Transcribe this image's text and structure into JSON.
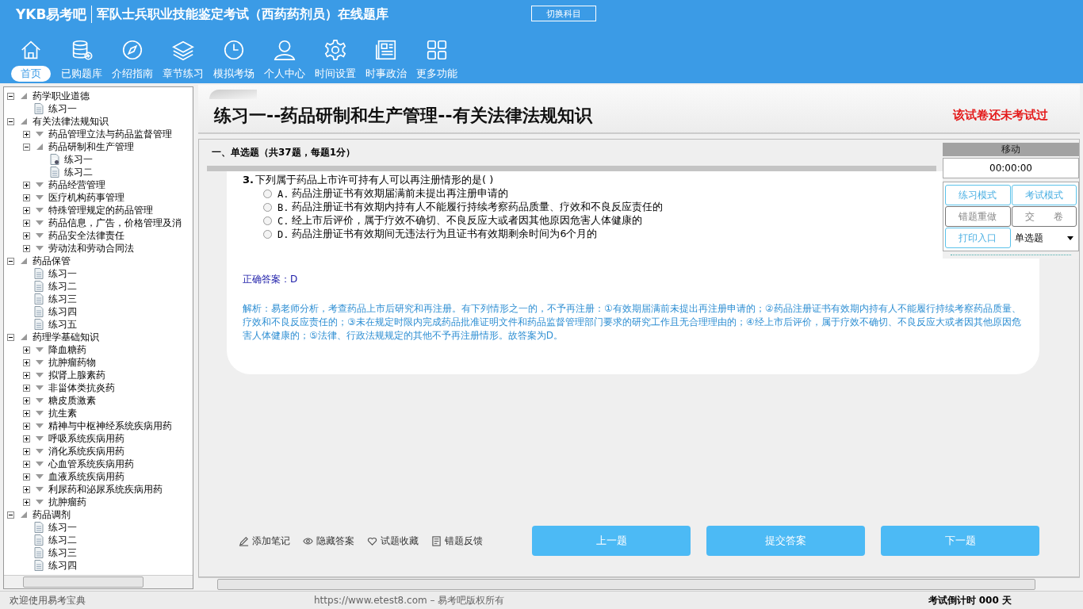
{
  "header": {
    "logo": "YKB易考吧",
    "title": "军队士兵职业技能鉴定考试（西药药剂员）在线题库",
    "switch_button": "切换科目"
  },
  "nav": [
    {
      "label": "首页",
      "selected": true
    },
    {
      "label": "已购题库",
      "selected": false
    },
    {
      "label": "介绍指南",
      "selected": false
    },
    {
      "label": "章节练习",
      "selected": false
    },
    {
      "label": "模拟考场",
      "selected": false
    },
    {
      "label": "个人中心",
      "selected": false
    },
    {
      "label": "时间设置",
      "selected": false
    },
    {
      "label": "时事政治",
      "selected": false
    },
    {
      "label": "更多功能",
      "selected": false
    }
  ],
  "tree": [
    {
      "kind": "folder",
      "label": "药学职业道德",
      "expanded": true,
      "children": [
        {
          "kind": "leaf",
          "label": "练习一",
          "selected": false
        }
      ]
    },
    {
      "kind": "folder",
      "label": "有关法律法规知识",
      "expanded": true,
      "children": [
        {
          "kind": "folder",
          "label": "药品管理立法与药品监督管理",
          "expanded": false
        },
        {
          "kind": "folder",
          "label": "药品研制和生产管理",
          "expanded": true,
          "children": [
            {
              "kind": "leaf",
              "label": "练习一",
              "selected": true
            },
            {
              "kind": "leaf",
              "label": "练习二",
              "selected": false
            }
          ]
        },
        {
          "kind": "folder",
          "label": "药品经营管理",
          "expanded": false
        },
        {
          "kind": "folder",
          "label": "医疗机构药事管理",
          "expanded": false
        },
        {
          "kind": "folder",
          "label": "特殊管理规定的药品管理",
          "expanded": false
        },
        {
          "kind": "folder",
          "label": "药品信息，广告，价格管理及消",
          "expanded": false
        },
        {
          "kind": "folder",
          "label": "药品安全法律责任",
          "expanded": false
        },
        {
          "kind": "folder",
          "label": "劳动法和劳动合同法",
          "expanded": false
        }
      ]
    },
    {
      "kind": "folder",
      "label": "药品保管",
      "expanded": true,
      "children": [
        {
          "kind": "leaf",
          "label": "练习一",
          "selected": false
        },
        {
          "kind": "leaf",
          "label": "练习二",
          "selected": false
        },
        {
          "kind": "leaf",
          "label": "练习三",
          "selected": false
        },
        {
          "kind": "leaf",
          "label": "练习四",
          "selected": false
        },
        {
          "kind": "leaf",
          "label": "练习五",
          "selected": false
        }
      ]
    },
    {
      "kind": "folder",
      "label": "药理学基础知识",
      "expanded": true,
      "children": [
        {
          "kind": "folder",
          "label": "降血糖药",
          "expanded": false
        },
        {
          "kind": "folder",
          "label": "抗肿瘤药物",
          "expanded": false
        },
        {
          "kind": "folder",
          "label": "拟肾上腺素药",
          "expanded": false
        },
        {
          "kind": "folder",
          "label": "非甾体类抗炎药",
          "expanded": false
        },
        {
          "kind": "folder",
          "label": "糖皮质激素",
          "expanded": false
        },
        {
          "kind": "folder",
          "label": "抗生素",
          "expanded": false
        },
        {
          "kind": "folder",
          "label": "精神与中枢神经系统疾病用药",
          "expanded": false
        },
        {
          "kind": "folder",
          "label": "呼吸系统疾病用药",
          "expanded": false
        },
        {
          "kind": "folder",
          "label": "消化系统疾病用药",
          "expanded": false
        },
        {
          "kind": "folder",
          "label": "心血管系统疾病用药",
          "expanded": false
        },
        {
          "kind": "folder",
          "label": "血液系统疾病用药",
          "expanded": false
        },
        {
          "kind": "folder",
          "label": "利尿药和泌尿系统疾病用药",
          "expanded": false
        },
        {
          "kind": "folder",
          "label": "抗肿瘤药",
          "expanded": false
        }
      ]
    },
    {
      "kind": "folder",
      "label": "药品调剂",
      "expanded": true,
      "children": [
        {
          "kind": "leaf",
          "label": "练习一",
          "selected": false
        },
        {
          "kind": "leaf",
          "label": "练习二",
          "selected": false
        },
        {
          "kind": "leaf",
          "label": "练习三",
          "selected": false
        },
        {
          "kind": "leaf",
          "label": "练习四",
          "selected": false
        }
      ]
    }
  ],
  "exam": {
    "title": "练习一--药品研制和生产管理--有关法律法规知识",
    "status": "该试卷还未考试过",
    "section": "一、单选题（共37题，每题1分）",
    "question_number": "3.",
    "question": "下列属于药品上市许可持有人可以再注册情形的是( )",
    "options": [
      {
        "label": "A.",
        "text": "药品注册证书有效期届满前未提出再注册申请的",
        "selected": false
      },
      {
        "label": "B.",
        "text": "药品注册证书有效期内持有人不能履行持续考察药品质量、疗效和不良反应责任的",
        "selected": false
      },
      {
        "label": "C.",
        "text": "经上市后评价，属于疗效不确切、不良反应大或者因其他原因危害人体健康的",
        "selected": false
      },
      {
        "label": "D.",
        "text": "药品注册证书有效期间无违法行为且证书有效期剩余时间为6个月的",
        "selected": false
      }
    ],
    "answer": "正确答案：D",
    "explanation": "解析：易老师分析，考查药品上市后研究和再注册。有下列情形之一的，不予再注册：①有效期届满前未提出再注册申请的；②药品注册证书有效期内持有人不能履行持续考察药品质量、疗效和不良反应责任的；③未在规定时限内完成药品批准证明文件和药品监督管理部门要求的研究工作且无合理理由的；④经上市后评价，属于疗效不确切、不良反应大或者因其他原因危害人体健康的；⑤法律、行政法规规定的其他不予再注册情形。故答案为D。"
  },
  "control_panel": {
    "title": "移动",
    "timer": "00:00:00",
    "buttons": [
      {
        "label": "练习模式",
        "disabled": false
      },
      {
        "label": "考试模式",
        "disabled": false
      },
      {
        "label": "错题重做",
        "disabled": true
      },
      {
        "label": "交　　卷",
        "disabled": true
      },
      {
        "label": "打印入口",
        "disabled": false
      }
    ],
    "type_select": "单选题"
  },
  "actions": [
    "添加笔记",
    "隐藏答案",
    "试题收藏",
    "错题反馈"
  ],
  "buttons": [
    "上一题",
    "提交答案",
    "下一题"
  ],
  "status_bar": {
    "welcome": "欢迎使用易考宝典",
    "copyright": "https://www.etest8.com – 易考吧版权所有",
    "countdown": "考试倒计时 000 天"
  }
}
